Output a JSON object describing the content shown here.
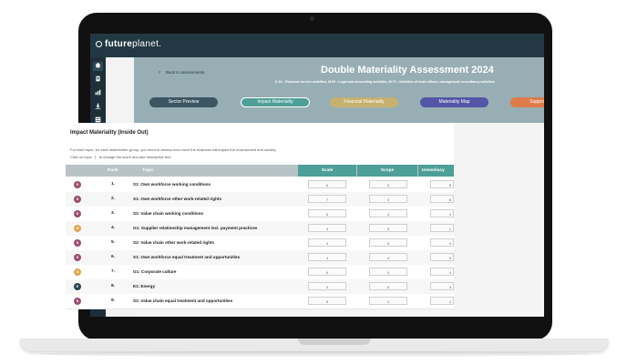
{
  "app": {
    "logo_bold": "future",
    "logo_light": "planet."
  },
  "header": {
    "back_label": "Back to assessments",
    "title": "Double Materiality Assessment 2024",
    "subtitle": "K.64 - Financial service activities, M.69 - Legal and accounting activities, M.70 - Activities of head offices; management consultancy activities"
  },
  "tabs": [
    {
      "label": "Sector Preview",
      "color": "#3b5561"
    },
    {
      "label": "Impact Materiality",
      "color": "#4e9f98"
    },
    {
      "label": "Financial Materiality",
      "color": "#c6b06f"
    },
    {
      "label": "Materiality Map",
      "color": "#5355a6"
    },
    {
      "label": "Support",
      "color": "#de7b48"
    }
  ],
  "section": {
    "title": "Impact Materiality (Inside Out)",
    "desc1": "For each topic, for each stakeholder group, you need to assess how much the business will impact the environment and society.",
    "desc2_pre": "Click on topic",
    "desc2_post": "to change the score and add descriptive text."
  },
  "table": {
    "columns": {
      "rank": "Rank",
      "topic": "Topic",
      "scale": "Scale",
      "scope": "Scope",
      "immediacy": "Immediacy"
    },
    "rows": [
      {
        "badge": "S",
        "badge_color": "#9b4f72",
        "rank": "1.",
        "topic": "S1: Own workforce working conditions",
        "scale": "6",
        "scope": "5",
        "immediacy": "6"
      },
      {
        "badge": "S",
        "badge_color": "#9b4f72",
        "rank": "2.",
        "topic": "S1: Own workforce other work-related rights",
        "scale": "7",
        "scope": "3",
        "immediacy": "6"
      },
      {
        "badge": "S",
        "badge_color": "#9b4f72",
        "rank": "3.",
        "topic": "S2: Value chain working conditions",
        "scale": "6",
        "scope": "4",
        "immediacy": "4"
      },
      {
        "badge": "G",
        "badge_color": "#e0a84e",
        "rank": "4.",
        "topic": "G1: Supplier relationship management incl. payment practices",
        "scale": "4",
        "scope": "3",
        "immediacy": "1"
      },
      {
        "badge": "S",
        "badge_color": "#9b4f72",
        "rank": "5.",
        "topic": "S2: Value chain other work-related rights",
        "scale": "4",
        "scope": "6",
        "immediacy": "4"
      },
      {
        "badge": "S",
        "badge_color": "#9b4f72",
        "rank": "6.",
        "topic": "S1: Own workforce equal treatment and opportunities",
        "scale": "4",
        "scope": "4",
        "immediacy": "5"
      },
      {
        "badge": "G",
        "badge_color": "#e0a84e",
        "rank": "7.",
        "topic": "G1: Corporate culture",
        "scale": "6",
        "scope": "4",
        "immediacy": "4"
      },
      {
        "badge": "E",
        "badge_color": "#25474d",
        "rank": "8.",
        "topic": "E1: Energy",
        "scale": "4",
        "scope": "6",
        "immediacy": "4"
      },
      {
        "badge": "S",
        "badge_color": "#9b4f72",
        "rank": "9.",
        "topic": "S2: Value chain equal treatment and opportunities",
        "scale": "5",
        "scope": "4",
        "immediacy": "4"
      }
    ]
  },
  "sidebar": {
    "icons": [
      "home-icon",
      "document-icon",
      "chart-icon",
      "download-icon",
      "list-icon",
      "calculator-icon",
      "globe-settings-icon"
    ]
  }
}
